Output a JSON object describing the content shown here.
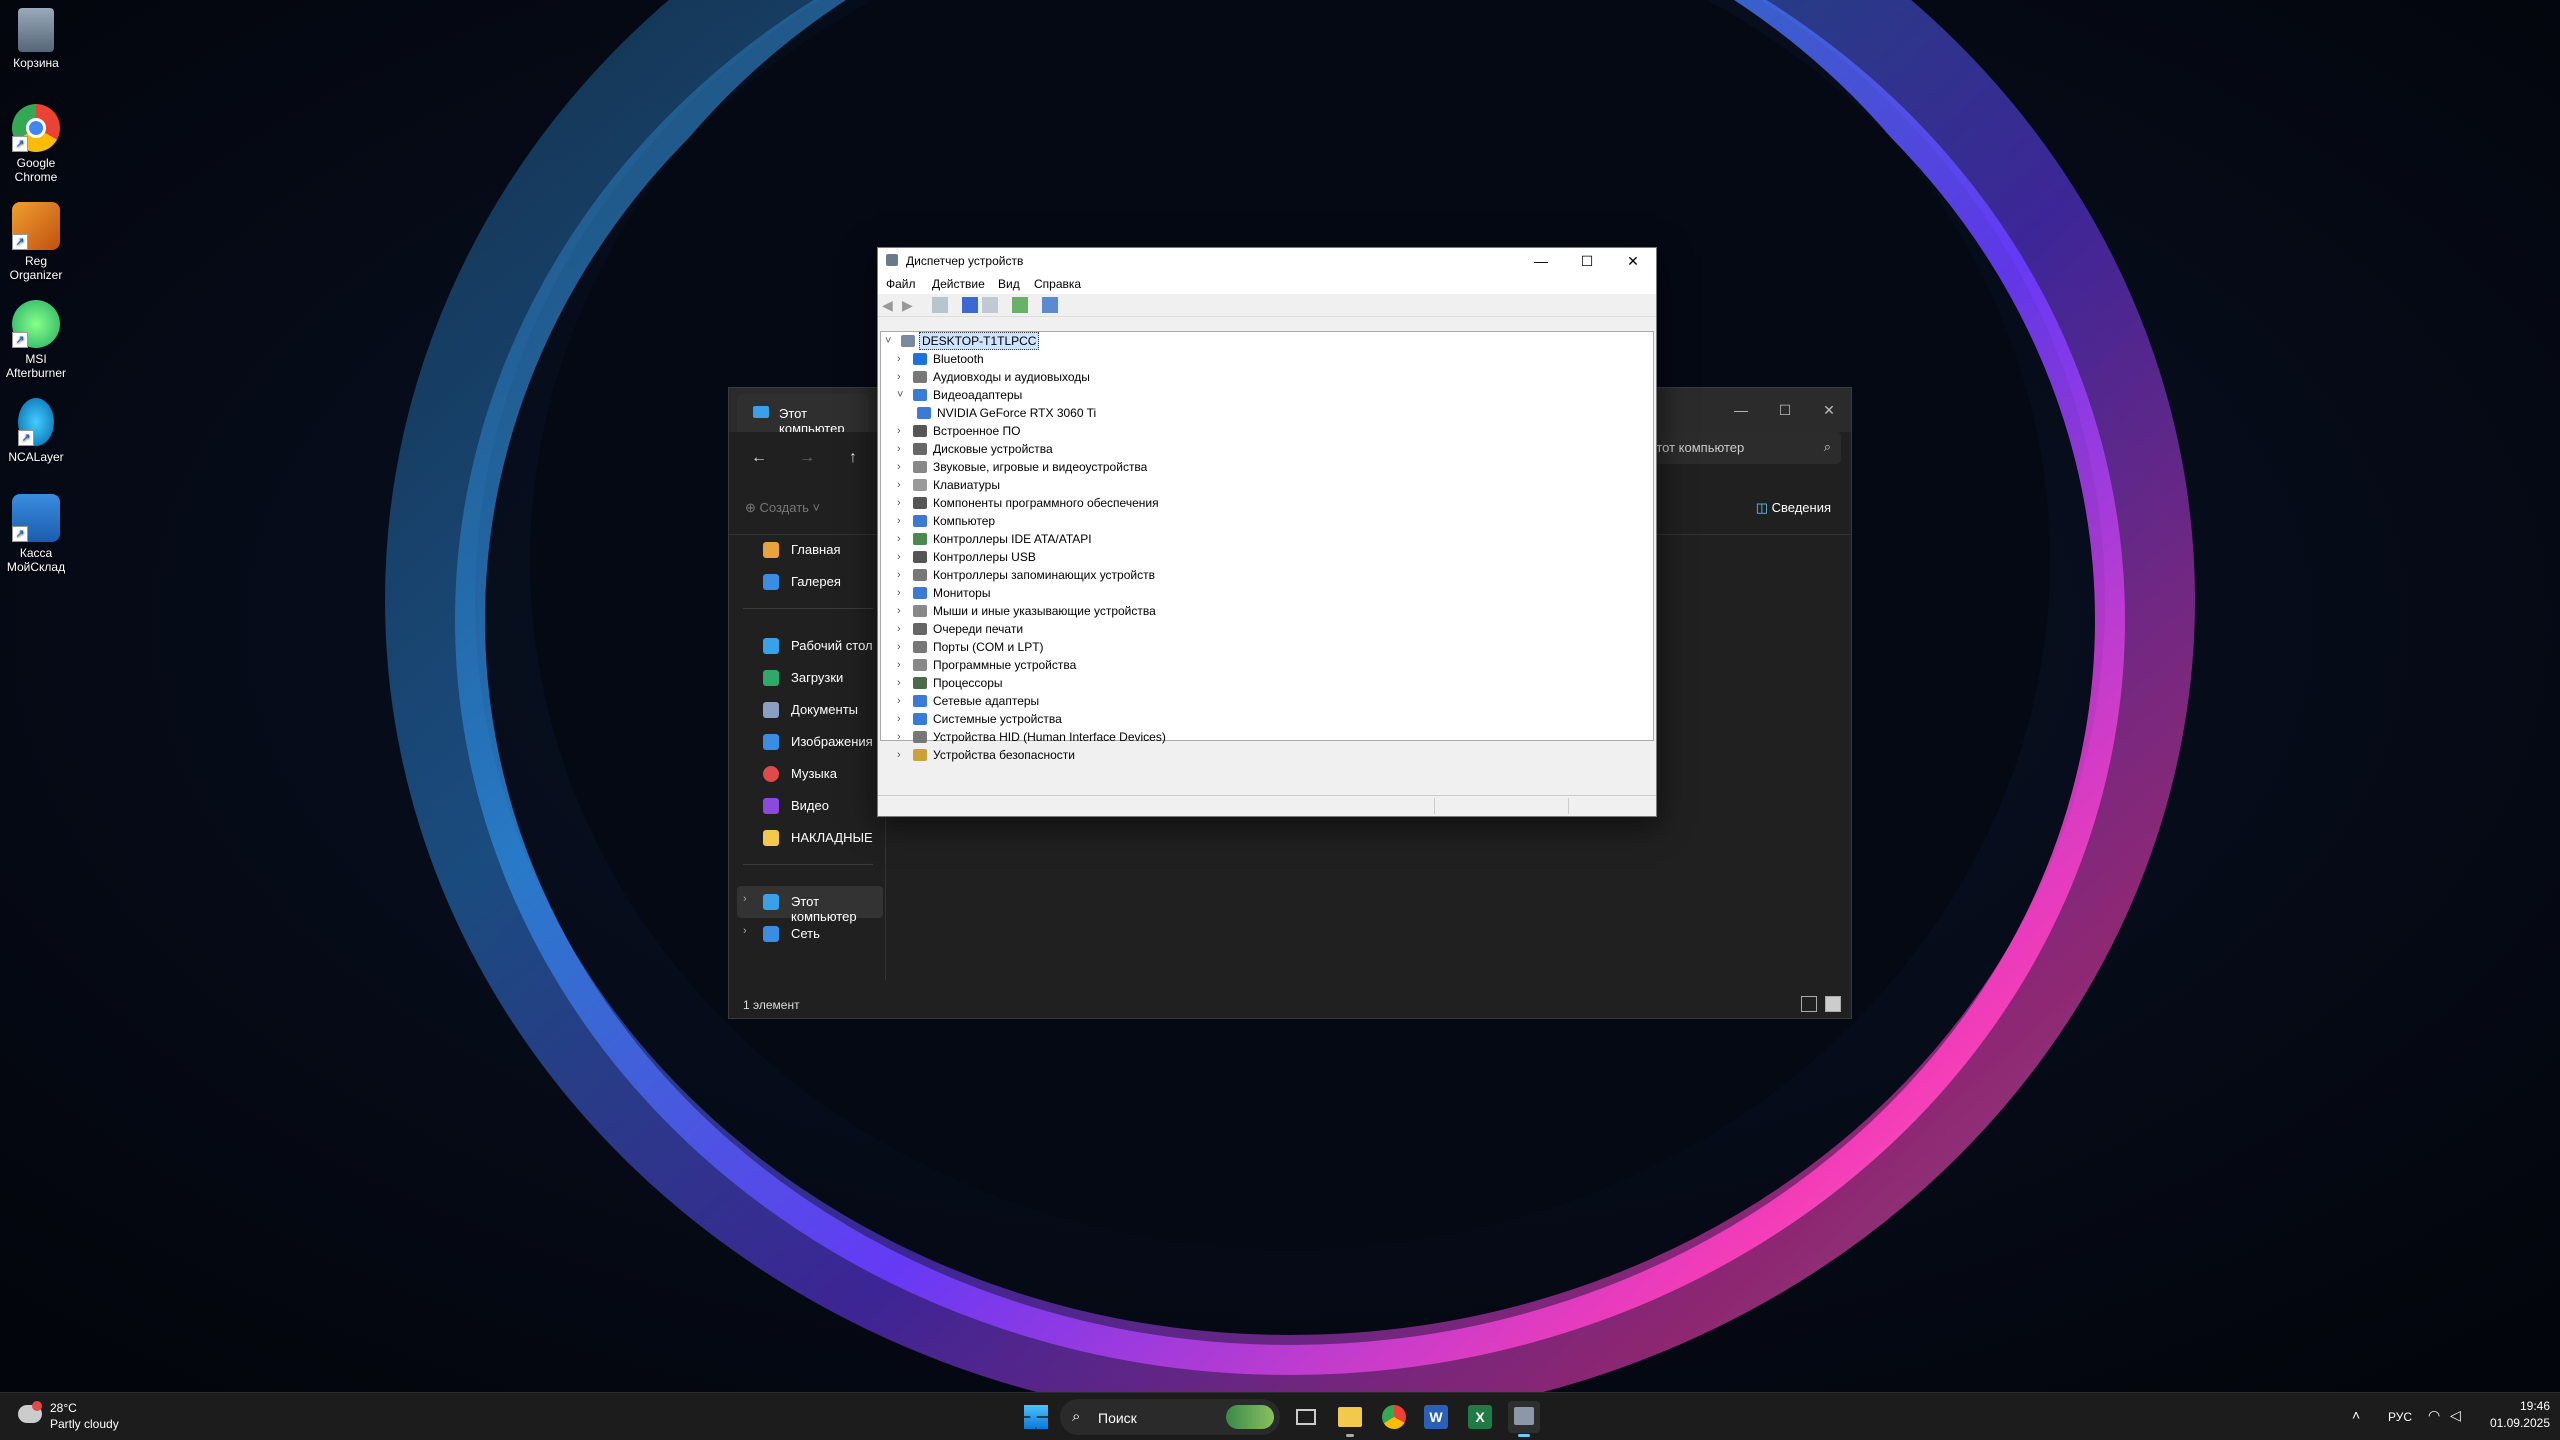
{
  "desktop": {
    "icons": [
      {
        "label": "Корзина",
        "icon": "recycle-bin-icon"
      },
      {
        "label": "Google Chrome",
        "icon": "chrome-icon"
      },
      {
        "label": "Reg Organizer",
        "icon": "reg-organizer-icon"
      },
      {
        "label": "MSI Afterburner",
        "icon": "msi-afterburner-icon"
      },
      {
        "label": "NCALayer",
        "icon": "ncalayer-icon"
      },
      {
        "label": "Касса МойСклад",
        "icon": "kassa-icon"
      }
    ]
  },
  "explorer": {
    "tab_title": "Этот компьютер",
    "search_placeholder": "Этот компьютер",
    "create_label": "Создать",
    "details_label": "Сведения",
    "nav": {
      "home": "Главная",
      "gallery": "Галерея",
      "desktop": "Рабочий стол",
      "downloads": "Загрузки",
      "documents": "Документы",
      "images": "Изображения",
      "music": "Музыка",
      "video": "Видео",
      "folder": "НАКЛАДНЫЕ",
      "this_pc": "Этот компьютер",
      "network": "Сеть"
    },
    "status": "1 элемент"
  },
  "devmgr": {
    "title": "Диспетчер устройств",
    "menu": {
      "file": "Файл",
      "action": "Действие",
      "view": "Вид",
      "help": "Справка"
    },
    "root": "DESKTOP-T1TLPCC",
    "items": [
      {
        "label": "Bluetooth",
        "expanded": false,
        "color": "#1e73d8"
      },
      {
        "label": "Аудиовходы и аудиовыходы",
        "expanded": false,
        "color": "#777777"
      },
      {
        "label": "Видеоадаптеры",
        "expanded": true,
        "color": "#3a7bd5"
      },
      {
        "label": "NVIDIA GeForce RTX 3060 Ti",
        "child": true,
        "color": "#3a7bd5"
      },
      {
        "label": "Встроенное ПО",
        "expanded": false,
        "color": "#555555"
      },
      {
        "label": "Дисковые устройства",
        "expanded": false,
        "color": "#666666"
      },
      {
        "label": "Звуковые, игровые и видеоустройства",
        "expanded": false,
        "color": "#888888"
      },
      {
        "label": "Клавиатуры",
        "expanded": false,
        "color": "#999999"
      },
      {
        "label": "Компоненты программного обеспечения",
        "expanded": false,
        "color": "#555555"
      },
      {
        "label": "Компьютер",
        "expanded": false,
        "color": "#3a7bd5"
      },
      {
        "label": "Контроллеры IDE ATA/ATAPI",
        "expanded": false,
        "color": "#4a8a4a"
      },
      {
        "label": "Контроллеры USB",
        "expanded": false,
        "color": "#555555"
      },
      {
        "label": "Контроллеры запоминающих устройств",
        "expanded": false,
        "color": "#777777"
      },
      {
        "label": "Мониторы",
        "expanded": false,
        "color": "#3a7bd5"
      },
      {
        "label": "Мыши и иные указывающие устройства",
        "expanded": false,
        "color": "#888888"
      },
      {
        "label": "Очереди печати",
        "expanded": false,
        "color": "#666666"
      },
      {
        "label": "Порты (COM и LPT)",
        "expanded": false,
        "color": "#777777"
      },
      {
        "label": "Программные устройства",
        "expanded": false,
        "color": "#888888"
      },
      {
        "label": "Процессоры",
        "expanded": false,
        "color": "#4a6a4a"
      },
      {
        "label": "Сетевые адаптеры",
        "expanded": false,
        "color": "#3a7bd5"
      },
      {
        "label": "Системные устройства",
        "expanded": false,
        "color": "#3a7bd5"
      },
      {
        "label": "Устройства HID (Human Interface Devices)",
        "expanded": false,
        "color": "#777777"
      },
      {
        "label": "Устройства безопасности",
        "expanded": false,
        "color": "#c9a23a"
      }
    ]
  },
  "taskbar": {
    "weather_temp": "28°C",
    "weather_desc": "Partly cloudy",
    "search_label": "Поиск",
    "lang": "РУС",
    "time": "19:46",
    "date": "01.09.2025"
  }
}
